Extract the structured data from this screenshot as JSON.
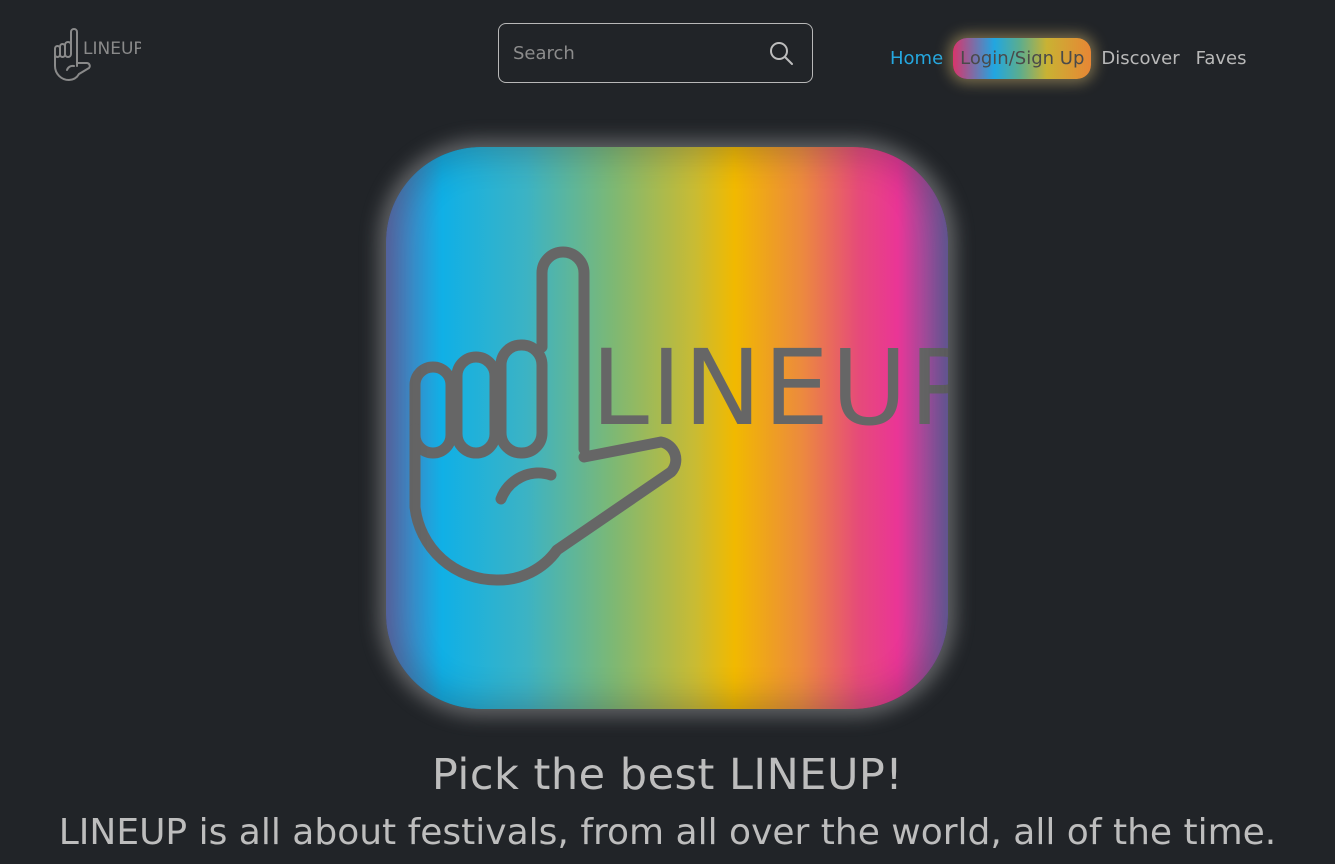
{
  "header": {
    "brand_text": "LINEUP",
    "search": {
      "placeholder": "Search",
      "value": "",
      "icon": "search-icon"
    },
    "nav": {
      "home": "Home",
      "login": "Login/Sign Up",
      "discover": "Discover",
      "faves": "Faves"
    }
  },
  "hero": {
    "logo_text": "LINEUP",
    "logo_icon": "hand-l-logo-icon",
    "title": "Pick the best LINEUP!",
    "subtitle": "LINEUP is all about festivals, from all over the world, all of the time."
  },
  "colors": {
    "background": "#212428",
    "active_link": "#25a8e0",
    "text": "#bdbdbd",
    "logo_stroke": "#666666"
  }
}
